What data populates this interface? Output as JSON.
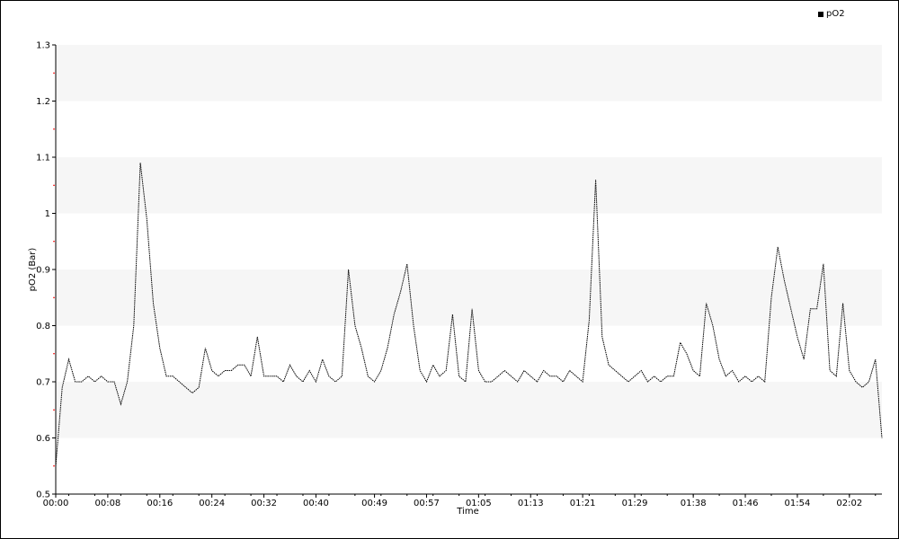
{
  "chart_data": {
    "type": "line",
    "title": "",
    "xlabel": "Time",
    "ylabel": "pO2 (Bar)",
    "ylim": [
      0.5,
      1.3
    ],
    "xlim": [
      "00:00",
      "02:07"
    ],
    "yticks": [
      "0.5",
      "0.6",
      "0.7",
      "0.8",
      "0.9",
      "1",
      "1.1",
      "1.2",
      "1.3"
    ],
    "xticks": [
      "00:00",
      "00:08",
      "00:16",
      "00:24",
      "00:32",
      "00:40",
      "00:49",
      "00:57",
      "01:05",
      "01:13",
      "01:21",
      "01:29",
      "01:38",
      "01:46",
      "01:54",
      "02:02"
    ],
    "grid": "alternating horizontal bands",
    "legend": {
      "position": "top-right",
      "entries": [
        "pO2"
      ]
    },
    "colors": {
      "line": "#000000",
      "band": "#f6f6f6",
      "minor_tick": "#ff0000"
    },
    "series": [
      {
        "name": "pO2",
        "x": [
          "00:00",
          "00:01",
          "00:02",
          "00:03",
          "00:04",
          "00:05",
          "00:06",
          "00:07",
          "00:08",
          "00:09",
          "00:10",
          "00:11",
          "00:12",
          "00:13",
          "00:14",
          "00:15",
          "00:16",
          "00:17",
          "00:18",
          "00:19",
          "00:20",
          "00:21",
          "00:22",
          "00:23",
          "00:24",
          "00:25",
          "00:26",
          "00:27",
          "00:28",
          "00:29",
          "00:30",
          "00:31",
          "00:32",
          "00:33",
          "00:34",
          "00:35",
          "00:36",
          "00:37",
          "00:38",
          "00:39",
          "00:40",
          "00:41",
          "00:42",
          "00:43",
          "00:44",
          "00:45",
          "00:46",
          "00:47",
          "00:48",
          "00:49",
          "00:50",
          "00:51",
          "00:52",
          "00:53",
          "00:54",
          "00:55",
          "00:56",
          "00:57",
          "00:58",
          "00:59",
          "01:00",
          "01:01",
          "01:02",
          "01:03",
          "01:04",
          "01:05",
          "01:06",
          "01:07",
          "01:08",
          "01:09",
          "01:10",
          "01:11",
          "01:12",
          "01:13",
          "01:14",
          "01:15",
          "01:16",
          "01:17",
          "01:18",
          "01:19",
          "01:20",
          "01:21",
          "01:22",
          "01:23",
          "01:24",
          "01:25",
          "01:26",
          "01:27",
          "01:28",
          "01:29",
          "01:30",
          "01:31",
          "01:32",
          "01:33",
          "01:34",
          "01:35",
          "01:36",
          "01:37",
          "01:38",
          "01:39",
          "01:40",
          "01:41",
          "01:42",
          "01:43",
          "01:44",
          "01:45",
          "01:46",
          "01:47",
          "01:48",
          "01:49",
          "01:50",
          "01:51",
          "01:52",
          "01:53",
          "01:54",
          "01:55",
          "01:56",
          "01:57",
          "01:58",
          "01:59",
          "02:00",
          "02:01",
          "02:02",
          "02:03",
          "02:04",
          "02:05",
          "02:06",
          "02:07"
        ],
        "values": [
          0.55,
          0.69,
          0.74,
          0.7,
          0.7,
          0.71,
          0.7,
          0.71,
          0.7,
          0.7,
          0.66,
          0.7,
          0.8,
          1.09,
          0.99,
          0.84,
          0.76,
          0.71,
          0.71,
          0.7,
          0.69,
          0.68,
          0.69,
          0.76,
          0.72,
          0.71,
          0.72,
          0.72,
          0.73,
          0.73,
          0.71,
          0.78,
          0.71,
          0.71,
          0.71,
          0.7,
          0.73,
          0.71,
          0.7,
          0.72,
          0.7,
          0.74,
          0.71,
          0.7,
          0.71,
          0.9,
          0.8,
          0.76,
          0.71,
          0.7,
          0.72,
          0.76,
          0.82,
          0.86,
          0.91,
          0.8,
          0.72,
          0.7,
          0.73,
          0.71,
          0.72,
          0.82,
          0.71,
          0.7,
          0.83,
          0.72,
          0.7,
          0.7,
          0.71,
          0.72,
          0.71,
          0.7,
          0.72,
          0.71,
          0.7,
          0.72,
          0.71,
          0.71,
          0.7,
          0.72,
          0.71,
          0.7,
          0.81,
          1.06,
          0.78,
          0.73,
          0.72,
          0.71,
          0.7,
          0.71,
          0.72,
          0.7,
          0.71,
          0.7,
          0.71,
          0.71,
          0.77,
          0.75,
          0.72,
          0.71,
          0.84,
          0.8,
          0.74,
          0.71,
          0.72,
          0.7,
          0.71,
          0.7,
          0.71,
          0.7,
          0.85,
          0.94,
          0.88,
          0.83,
          0.78,
          0.74,
          0.83,
          0.83,
          0.91,
          0.72,
          0.71,
          0.84,
          0.72,
          0.7,
          0.69,
          0.7,
          0.74,
          0.6
        ]
      }
    ]
  }
}
